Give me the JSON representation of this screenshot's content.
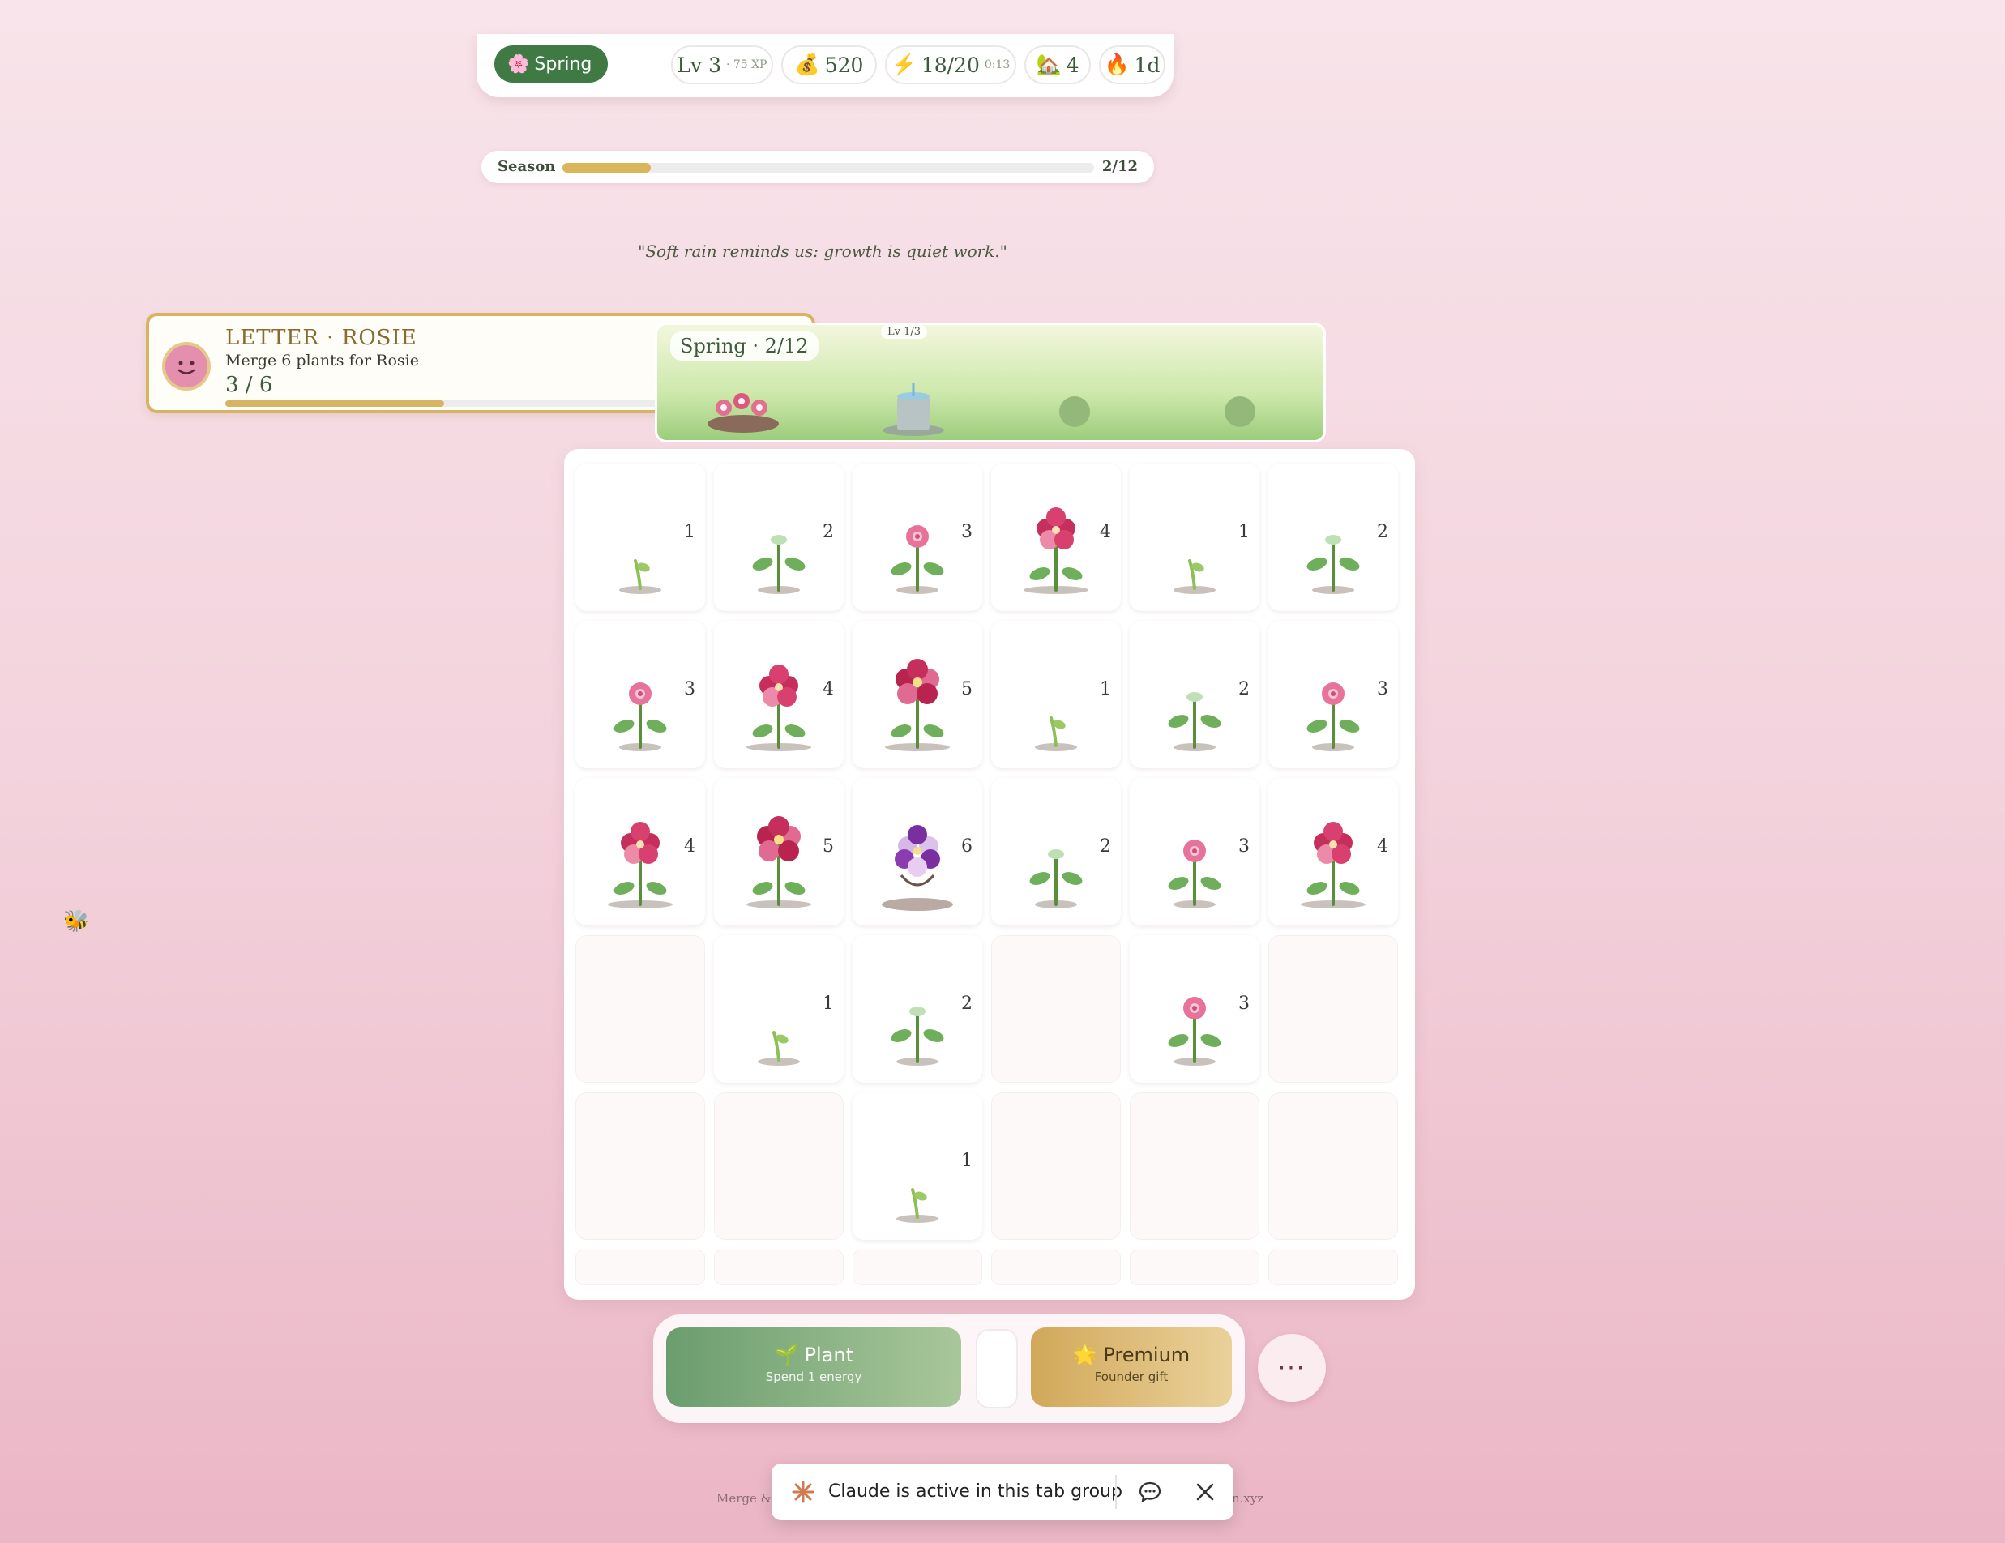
{
  "topbar": {
    "season": "Spring",
    "level": "Lv 3",
    "xp": "· 75 XP",
    "coins": "520",
    "energy": "18/20",
    "energy_timer": "0:13",
    "houses": "4",
    "streak": "1d"
  },
  "season_progress": {
    "label": "Season",
    "count": "2/12",
    "fraction": 0.1667
  },
  "quote": "\"Soft rain reminds us: growth is quiet work.\"",
  "letter": {
    "title": "LETTER · ROSIE",
    "description": "Merge 6 plants for Rosie",
    "progress_text": "3 / 6",
    "progress_fraction": 0.5
  },
  "scene": {
    "title": "Spring · 2/12",
    "level": "Lv 1/3"
  },
  "board": {
    "rows": [
      [
        1,
        2,
        3,
        4,
        1,
        2
      ],
      [
        3,
        4,
        5,
        1,
        2,
        3
      ],
      [
        4,
        5,
        6,
        2,
        3,
        4
      ],
      [
        null,
        1,
        2,
        null,
        3,
        null
      ],
      [
        null,
        null,
        1,
        null,
        null,
        null
      ]
    ]
  },
  "actions": {
    "plant_label": "Plant",
    "plant_sub": "Spend 1 energy",
    "premium_label": "Premium",
    "premium_sub": "Founder gift",
    "more_label": "···"
  },
  "footer": {
    "left": "Merge & I",
    "right": "n.xyz"
  },
  "toast": {
    "message": "Claude is active in this tab group"
  },
  "colors": {
    "accent_green": "#3f7a45",
    "gold": "#d6b463",
    "pink_bg": "#f3d3dd"
  }
}
